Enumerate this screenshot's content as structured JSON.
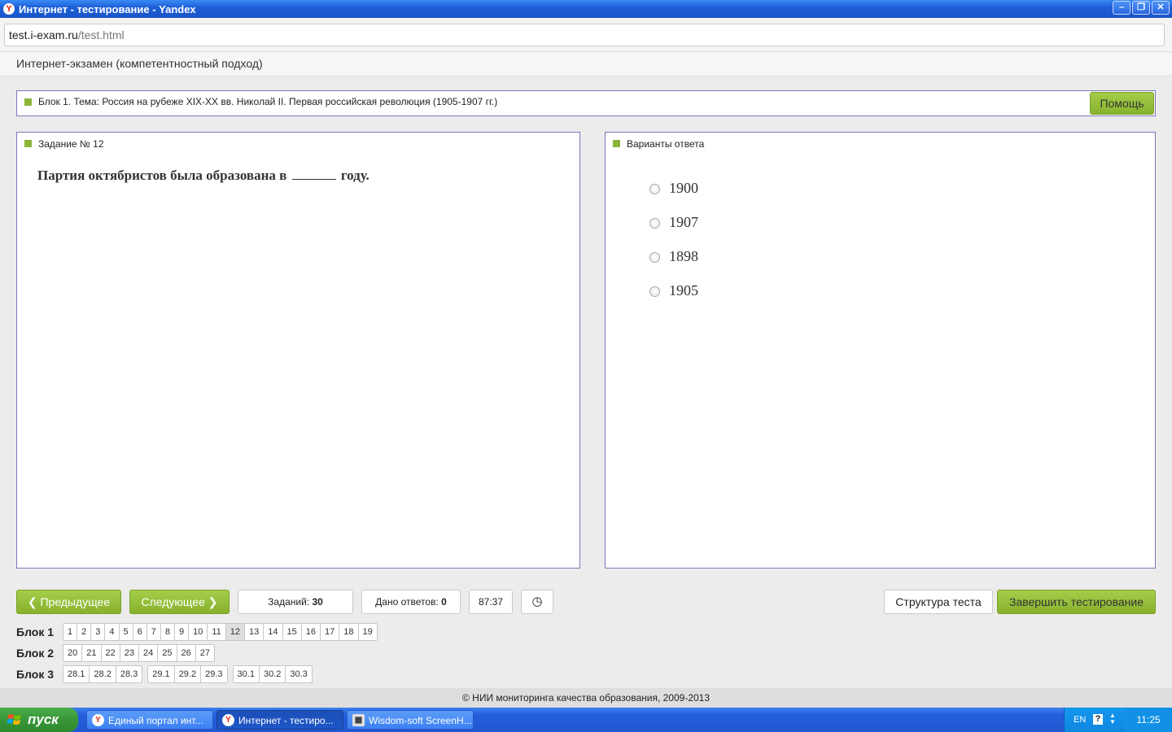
{
  "window": {
    "title": "Интернет - тестирование - Yandex",
    "minimize": "–",
    "restore": "❐",
    "close": "✕"
  },
  "address": {
    "domain": "test.i-exam.ru",
    "path": "/test.html"
  },
  "exam_header": "Интернет-экзамен (компетентностный подход)",
  "block_topic": "Блок 1. Тема: Россия на рубеже XIX-XX вв. Николай II. Первая российская революция (1905-1907 гг.)",
  "help_label": "Помощь",
  "task": {
    "header": "Задание № 12",
    "question_before": "Партия октябристов была образована в",
    "question_after": "году."
  },
  "answers": {
    "header": "Варианты ответа",
    "options": [
      "1900",
      "1907",
      "1898",
      "1905"
    ]
  },
  "controls": {
    "prev_label": "Предыдущее",
    "next_label": "Следующее",
    "tasks_label": "Заданий:",
    "tasks_value": "30",
    "answered_label": "Дано ответов:",
    "answered_value": "0",
    "timer": "87:37",
    "structure_label": "Структура теста",
    "finish_label": "Завершить тестирование"
  },
  "blocks": [
    {
      "label": "Блок 1",
      "groups": [
        [
          "1",
          "2",
          "3",
          "4",
          "5",
          "6",
          "7",
          "8",
          "9",
          "10",
          "11",
          "12",
          "13",
          "14",
          "15",
          "16",
          "17",
          "18",
          "19"
        ]
      ]
    },
    {
      "label": "Блок 2",
      "groups": [
        [
          "20",
          "21",
          "22",
          "23",
          "24",
          "25",
          "26",
          "27"
        ]
      ]
    },
    {
      "label": "Блок 3",
      "groups": [
        [
          "28.1",
          "28.2",
          "28.3"
        ],
        [
          "29.1",
          "29.2",
          "29.3"
        ],
        [
          "30.1",
          "30.2",
          "30.3"
        ]
      ]
    }
  ],
  "active_task": "12",
  "footer": "© НИИ мониторинга качества образования, 2009-2013",
  "taskbar": {
    "start_label": "пуск",
    "items": [
      "Единый портал инт...",
      "Интернет - тестиро...",
      "Wisdom-soft ScreenH..."
    ],
    "lang": "EN",
    "clock": "11:25"
  },
  "colors": {
    "accent_green": "#8cb43a",
    "panel_border": "#7b78b8",
    "xp_blue": "#245edb"
  }
}
